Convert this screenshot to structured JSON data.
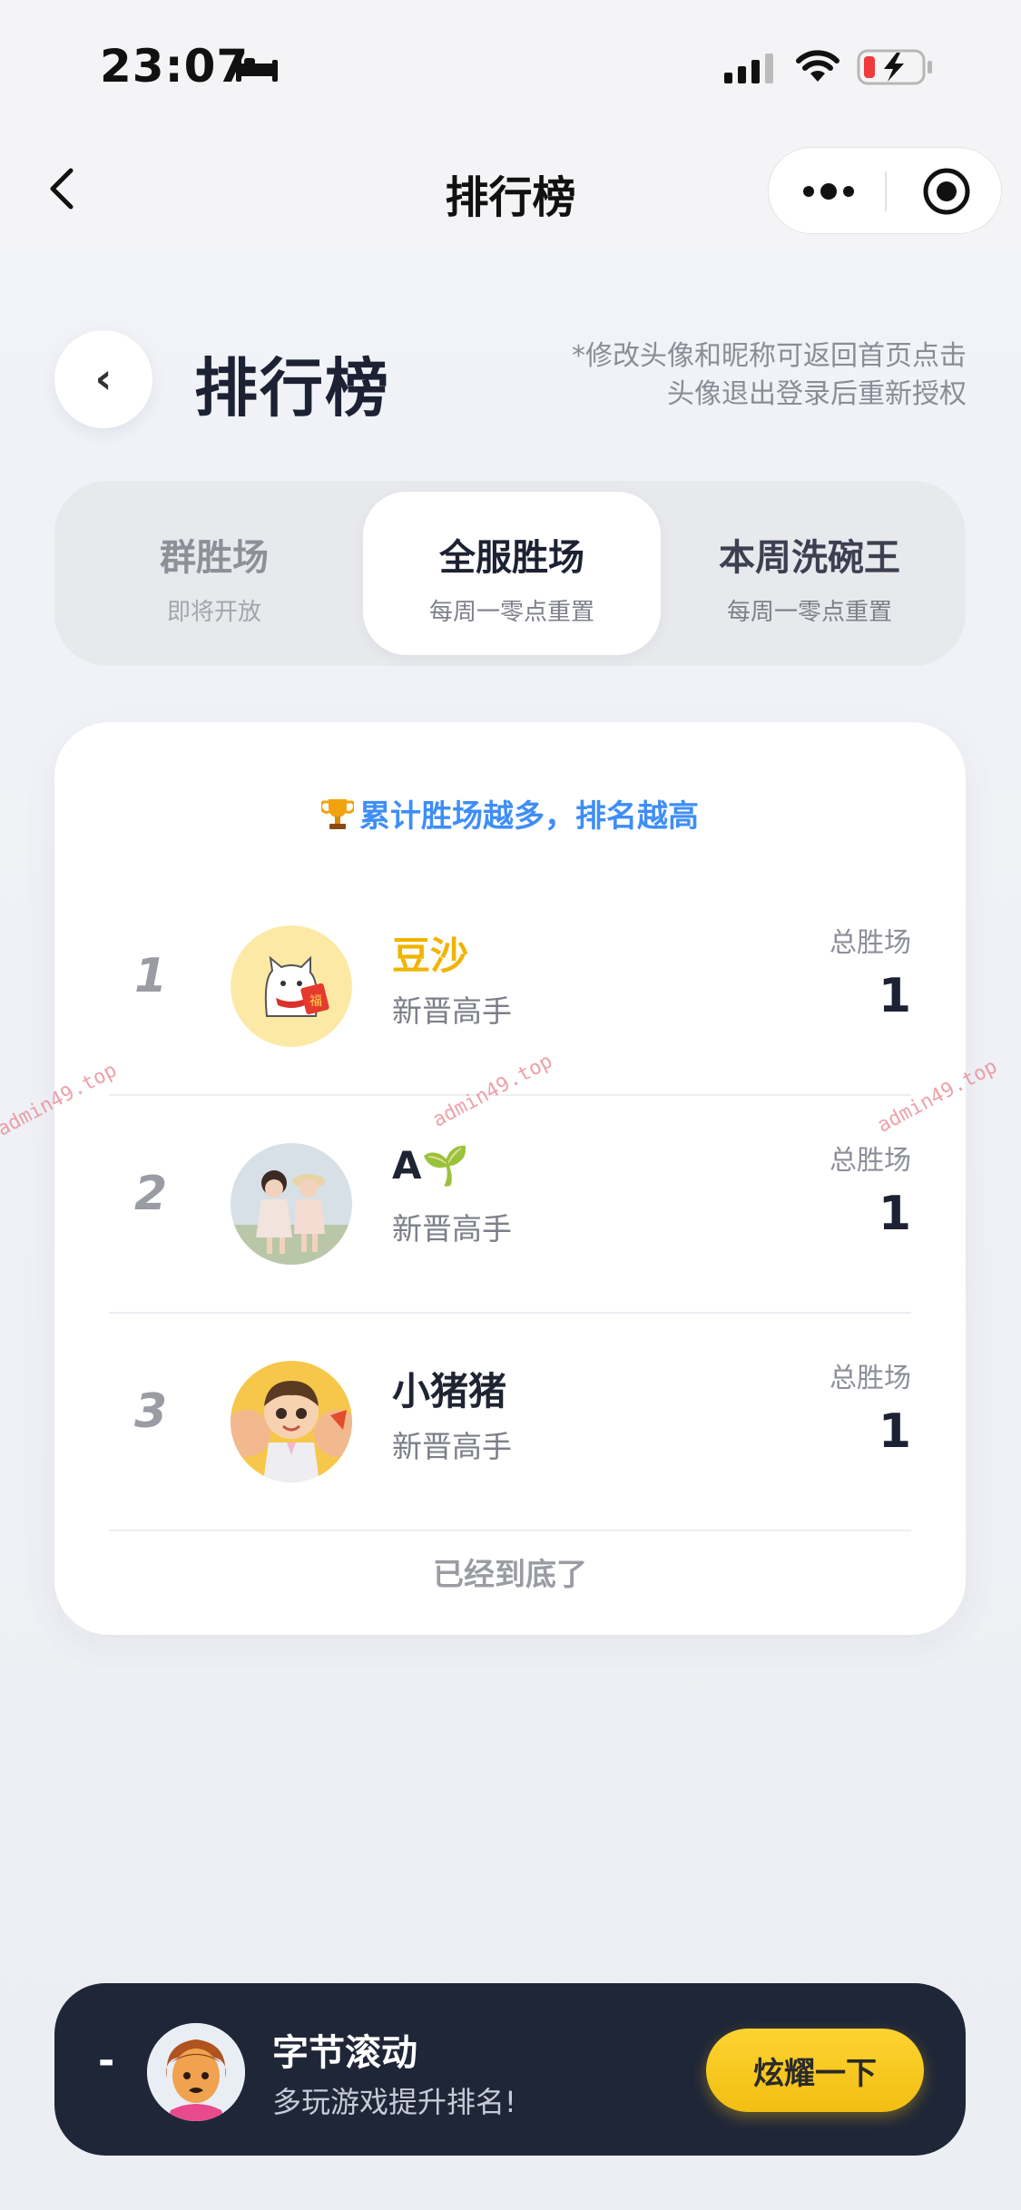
{
  "status_bar": {
    "time": "23:07"
  },
  "nav": {
    "title": "排行榜"
  },
  "header": {
    "back_glyph": "‹",
    "title": "排行榜",
    "note_line1": "*修改头像和昵称可返回首页点击",
    "note_line2": "头像退出登录后重新授权"
  },
  "tabs": [
    {
      "label": "群胜场",
      "sub": "即将开放",
      "active": false
    },
    {
      "label": "全服胜场",
      "sub": "每周一零点重置",
      "active": true
    },
    {
      "label": "本周洗碗王",
      "sub": "每周一零点重置",
      "active": false
    }
  ],
  "leaderboard": {
    "tip": "累计胜场越多，排名越高",
    "score_label": "总胜场",
    "rows": [
      {
        "rank": "1",
        "name": "豆沙",
        "level": "新晋高手",
        "score": "1",
        "highlight": true
      },
      {
        "rank": "2",
        "name": "A🌱",
        "level": "新晋高手",
        "score": "1",
        "highlight": false
      },
      {
        "rank": "3",
        "name": "小猪猪",
        "level": "新晋高手",
        "score": "1",
        "highlight": false
      }
    ],
    "end_text": "已经到底了"
  },
  "my_rank": {
    "rank": "-",
    "name": "字节滚动",
    "hint": "多玩游戏提升排名!",
    "button_label": "炫耀一下"
  },
  "watermark": "admin49.top",
  "colors": {
    "accent_blue": "#3e8ef7",
    "gold": "#f0b400",
    "button_yellow": "#f2be12",
    "bottom_bar": "#1f2638"
  },
  "icons": [
    "bed-icon",
    "signal-icon",
    "wifi-icon",
    "battery-charging-icon",
    "back-chevron-icon",
    "more-dots-icon",
    "target-icon",
    "trophy-icon"
  ]
}
